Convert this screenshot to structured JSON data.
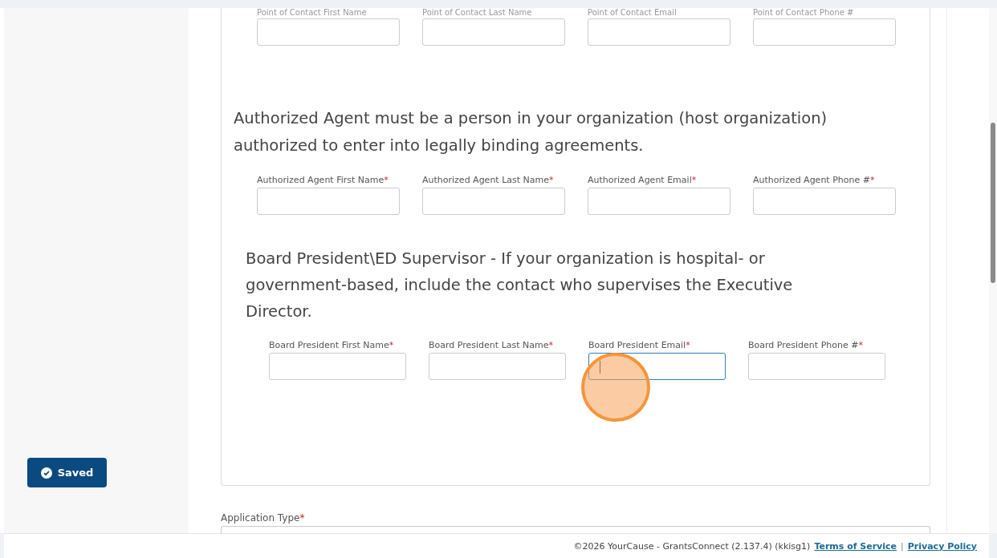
{
  "sidebar": {
    "save_status": {
      "label": "Saved"
    }
  },
  "form": {
    "sections": [
      {
        "fields": [
          {
            "label": "Point of Contact First Name",
            "focused": false
          },
          {
            "label": "Point of Contact Last Name",
            "focused": false
          },
          {
            "label": "Point of Contact Email",
            "focused": false
          },
          {
            "label": "Point of Contact Phone #",
            "focused": false
          }
        ]
      },
      {
        "heading": "Authorized Agent must be a person in your organization (host organization) authorized to enter into legally binding agreements.",
        "fields": [
          {
            "label": "Authorized Agent First Name",
            "required_mark": "*",
            "focused": false
          },
          {
            "label": "Authorized Agent Last Name",
            "required_mark": "*",
            "focused": false
          },
          {
            "label": "Authorized Agent Email",
            "required_mark": "*",
            "focused": false
          },
          {
            "label": "Authorized Agent Phone #",
            "required_mark": "*",
            "focused": false
          }
        ]
      },
      {
        "heading": "Board President\\ED Supervisor - If your organization is hospital- or government-based, include the contact who supervises the Executive Director.",
        "fields": [
          {
            "label": "Board President First Name",
            "required_mark": "*",
            "focused": false
          },
          {
            "label": "Board President Last Name",
            "required_mark": "*",
            "focused": false
          },
          {
            "label": "Board President Email",
            "required_mark": "*",
            "focused": true
          },
          {
            "label": "Board President Phone #",
            "required_mark": "*",
            "focused": false
          }
        ]
      }
    ],
    "application_type": {
      "label": "Application Type",
      "required_mark": "*"
    }
  },
  "footer": {
    "copyright": "©2026 YourCause - GrantsConnect (2.137.4) (kkisg1)",
    "links": [
      "Terms of Service",
      "Privacy Policy"
    ],
    "separator": "|"
  }
}
